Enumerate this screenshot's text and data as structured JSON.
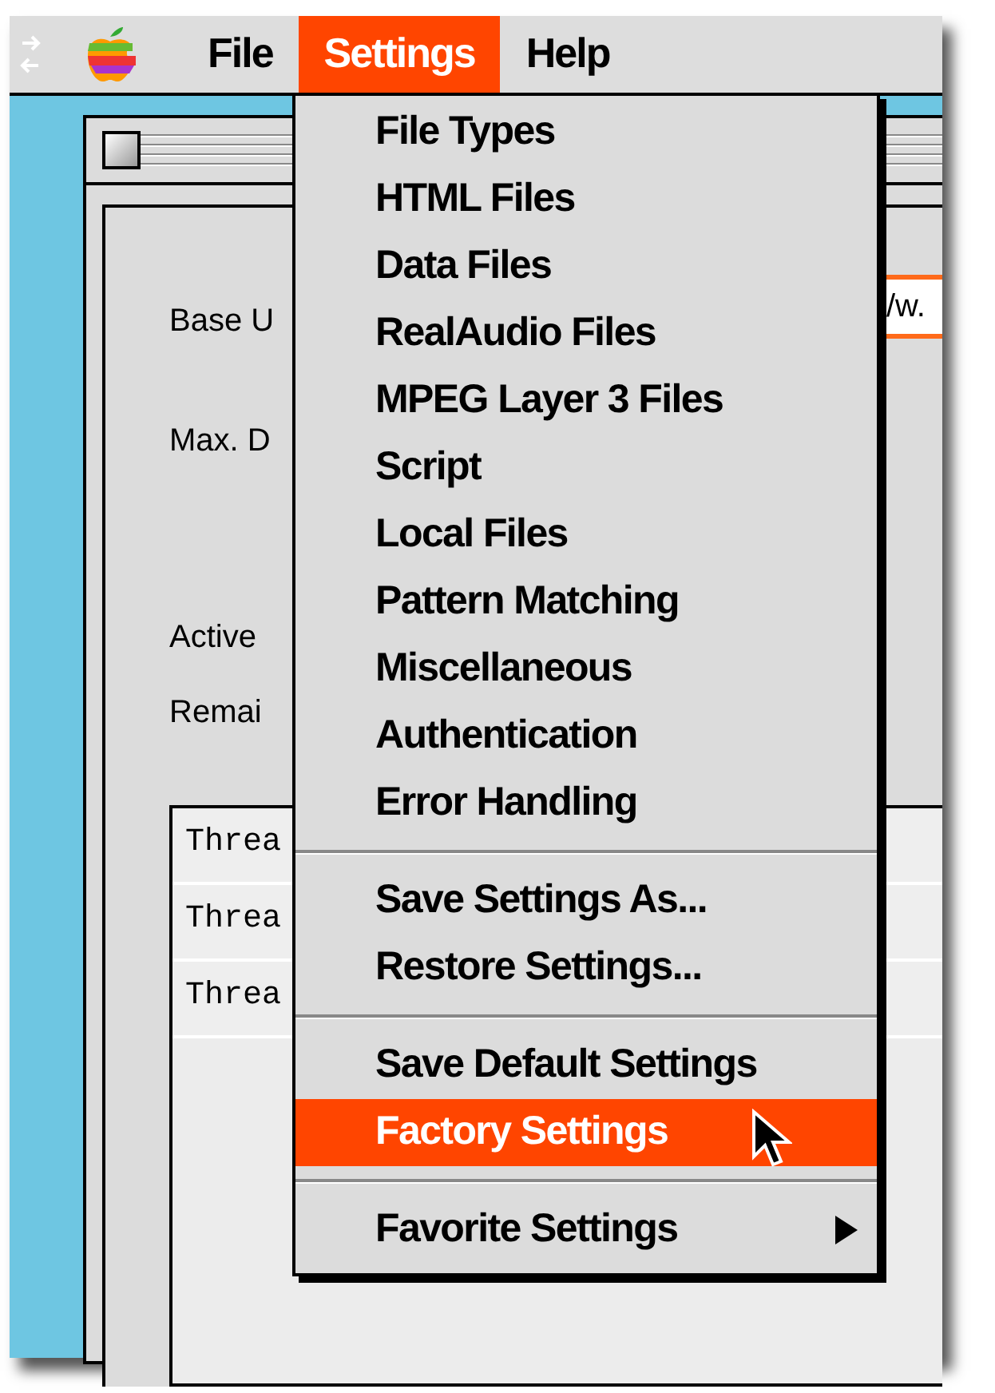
{
  "menu_bar": {
    "items": [
      {
        "label": "File",
        "selected": false
      },
      {
        "label": "Settings",
        "selected": true
      },
      {
        "label": "Help",
        "selected": false
      }
    ]
  },
  "window": {
    "labels": [
      "Base U",
      "Max. D",
      "Active",
      "Remai"
    ],
    "url_field": {
      "value": "/w."
    },
    "list_rows": [
      "Threa",
      "Threa",
      "Threa"
    ]
  },
  "menu": {
    "groups": [
      [
        {
          "label": "File Types",
          "selected": false,
          "submenu": false
        },
        {
          "label": "HTML Files",
          "selected": false,
          "submenu": false
        },
        {
          "label": "Data Files",
          "selected": false,
          "submenu": false
        },
        {
          "label": "RealAudio Files",
          "selected": false,
          "submenu": false
        },
        {
          "label": "MPEG Layer 3 Files",
          "selected": false,
          "submenu": false
        },
        {
          "label": "Script",
          "selected": false,
          "submenu": false
        },
        {
          "label": "Local Files",
          "selected": false,
          "submenu": false
        },
        {
          "label": "Pattern Matching",
          "selected": false,
          "submenu": false
        },
        {
          "label": "Miscellaneous",
          "selected": false,
          "submenu": false
        },
        {
          "label": "Authentication",
          "selected": false,
          "submenu": false
        },
        {
          "label": "Error Handling",
          "selected": false,
          "submenu": false
        }
      ],
      [
        {
          "label": "Save Settings As...",
          "selected": false,
          "submenu": false
        },
        {
          "label": "Restore Settings...",
          "selected": false,
          "submenu": false
        }
      ],
      [
        {
          "label": "Save Default Settings",
          "selected": false,
          "submenu": false
        },
        {
          "label": "Factory Settings",
          "selected": true,
          "submenu": false
        }
      ],
      [
        {
          "label": "Favorite Settings",
          "selected": false,
          "submenu": true
        }
      ]
    ]
  }
}
